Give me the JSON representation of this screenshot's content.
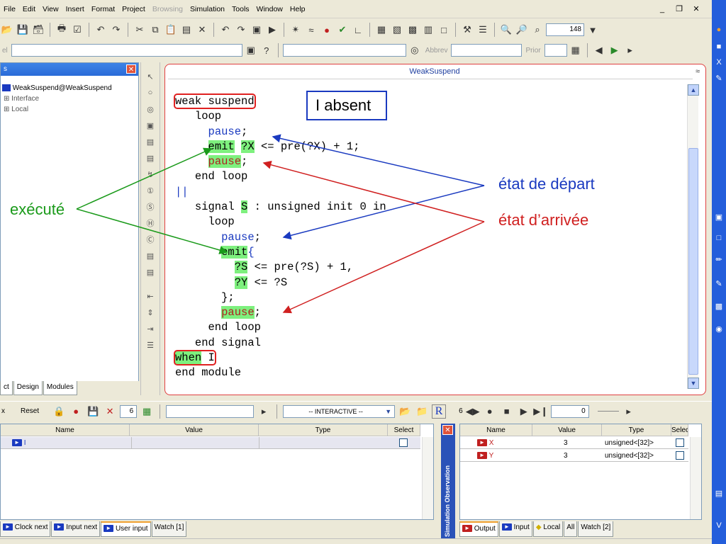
{
  "menu": {
    "items": [
      "File",
      "Edit",
      "View",
      "Insert",
      "Format",
      "Project",
      "Browsing",
      "Simulation",
      "Tools",
      "Window",
      "Help"
    ],
    "disabled": [
      "Browsing"
    ]
  },
  "window_controls": {
    "minimize": "_",
    "restore": "❐",
    "close": "✕"
  },
  "toolbar1": {
    "zoom_value": "148"
  },
  "toolbar2": {
    "label_fragment": "el",
    "abbrev_label": "Abbrev",
    "prior_label": "Prior"
  },
  "project_panel": {
    "title": "s",
    "tree": [
      {
        "label": "WeakSuspend@WeakSuspend",
        "kind": "root"
      },
      {
        "label": "Interface",
        "kind": "sub"
      },
      {
        "label": "Local",
        "kind": "sub"
      }
    ],
    "tabs": [
      "ct",
      "Design",
      "Modules"
    ]
  },
  "editor": {
    "title": "WeakSuspend",
    "code": [
      "weak suspend",
      "   loop",
      "     pause;",
      "     emit ?X <= pre(?X) + 1;",
      "     pause;",
      "   end loop",
      "||",
      "   signal S : unsigned init 0 in",
      "     loop",
      "       pause;",
      "       emit{",
      "         ?S <= pre(?S) + 1,",
      "         ?Y <= ?S",
      "       };",
      "       pause;",
      "     end loop",
      "   end signal",
      "when I",
      "end module"
    ]
  },
  "annotations": {
    "absent": "I absent",
    "depart": "état de départ",
    "arrivee": "état d’arrivée",
    "execute": "exécuté"
  },
  "simbar": {
    "left_label": "x",
    "reset_label": "Reset",
    "step_value": "6",
    "mode": "-- INTERACTIVE --",
    "counter": "6",
    "time_value": "0"
  },
  "input_table": {
    "headers": [
      "Name",
      "Value",
      "Type",
      "Select"
    ],
    "rows": [
      {
        "name": "I",
        "value": "",
        "type": ""
      }
    ],
    "tabs": [
      "Clock next",
      "Input next",
      "User input",
      "Watch [1]"
    ],
    "active_tab": "User input"
  },
  "observation": {
    "title": "Simulation Observation",
    "headers": [
      "Name",
      "Value",
      "Type",
      "Selec"
    ],
    "rows": [
      {
        "name": "X",
        "value": "3",
        "type": "unsigned<[32]>"
      },
      {
        "name": "Y",
        "value": "3",
        "type": "unsigned<[32]>"
      }
    ],
    "tabs": [
      "Output",
      "Input",
      "Local",
      "All",
      "Watch [2]"
    ],
    "active_tab": "Output"
  },
  "colors": {
    "highlight_green": "#7ef07e",
    "annotation_blue": "#1a3ac0",
    "annotation_red": "#d02020",
    "annotation_green": "#1a9a1a"
  }
}
